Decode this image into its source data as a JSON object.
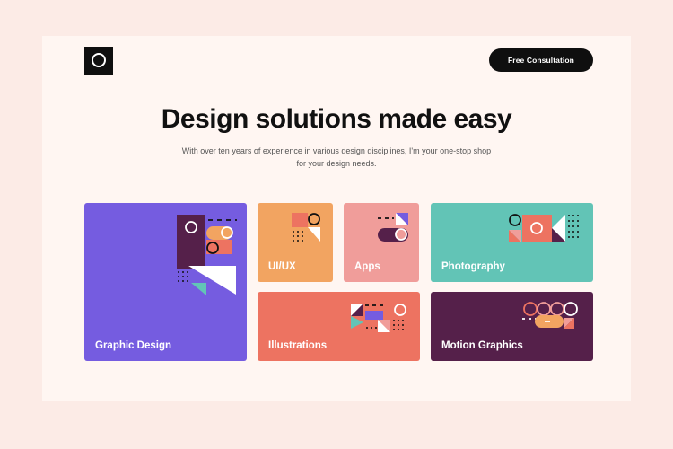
{
  "header": {
    "cta_label": "Free Consultation",
    "logo_icon": "ring-logo-icon"
  },
  "hero": {
    "title": "Design solutions made easy",
    "subtitle": "With over ten years of experience in various design disciplines, I'm your one-stop shop for your design needs."
  },
  "services": [
    {
      "label": "Graphic Design",
      "color": "#755ce0"
    },
    {
      "label": "UI/UX",
      "color": "#f2a461"
    },
    {
      "label": "Apps",
      "color": "#f09d9a"
    },
    {
      "label": "Photography",
      "color": "#62c4b6"
    },
    {
      "label": "Illustrations",
      "color": "#ed7361"
    },
    {
      "label": "Motion Graphics",
      "color": "#55204a"
    }
  ],
  "colors": {
    "background": "#fcebe6",
    "page": "#fff6f2",
    "dark": "#0f0f0f"
  }
}
